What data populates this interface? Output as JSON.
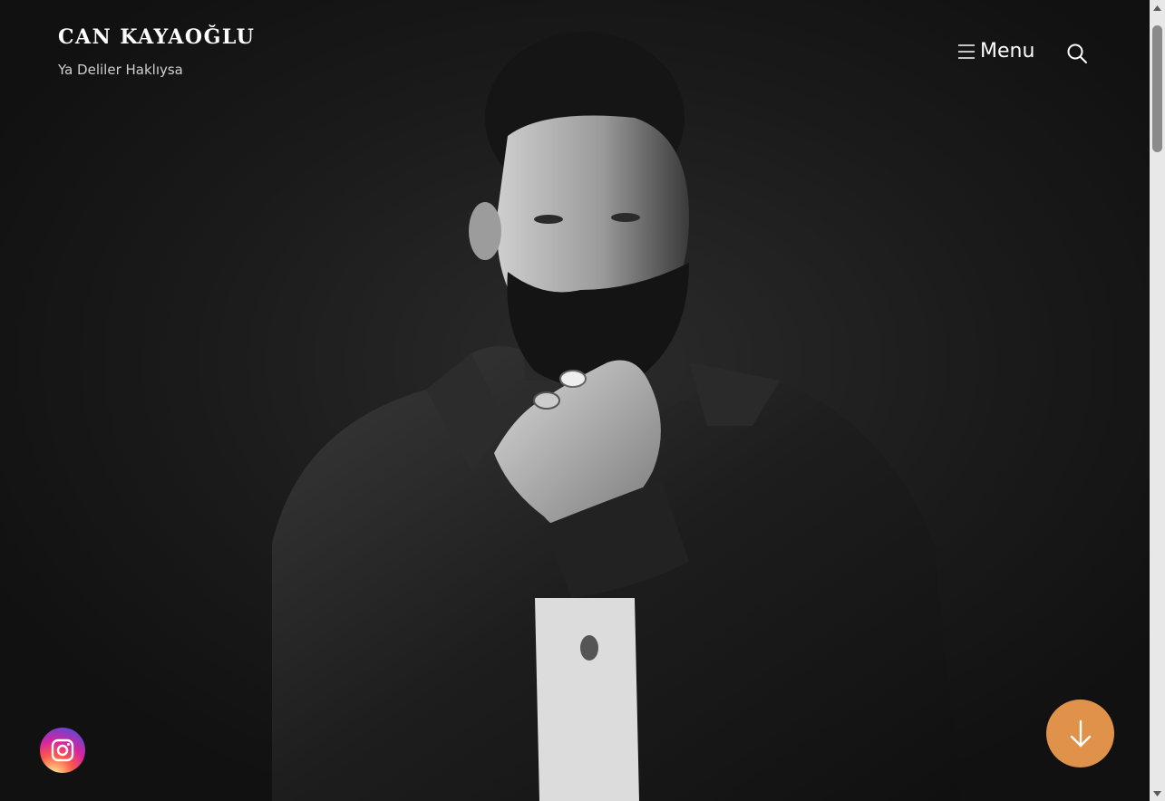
{
  "header": {
    "site_title": "CAN KAYAOĞLU",
    "tagline": "Ya Deliler Haklıysa",
    "menu_label": "Menu",
    "menu_icon": "hamburger-icon",
    "search_icon": "search-icon"
  },
  "hero": {
    "image": "black-and-white-portrait-photo"
  },
  "social": {
    "instagram_icon": "instagram-icon"
  },
  "scroll_down": {
    "icon": "arrow-down-icon",
    "color": "#e0924b"
  }
}
